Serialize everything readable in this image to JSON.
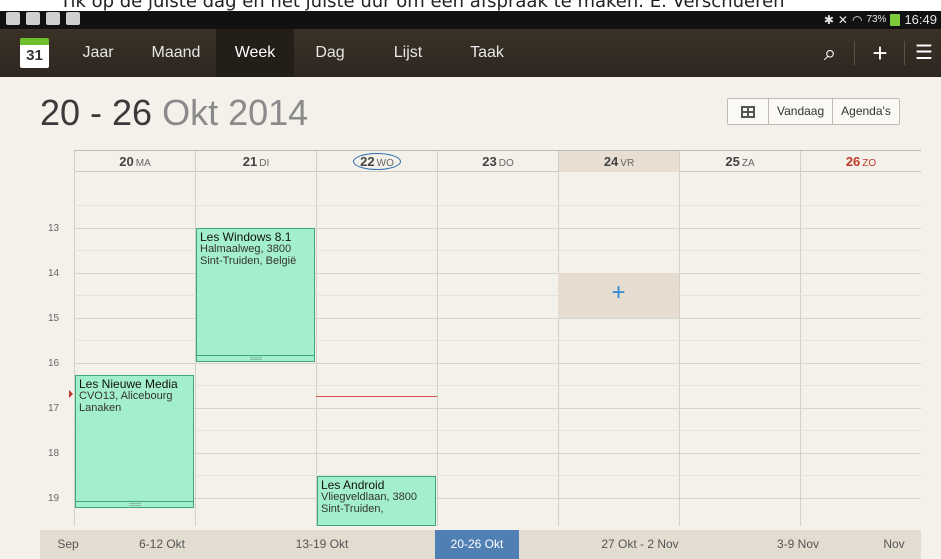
{
  "caption": "Tik op de juiste dag en het juiste uur om een afspraak te maken. E. Verschueren",
  "status": {
    "battery": "73%",
    "time": "16:49"
  },
  "app_icon_day": "31",
  "tabs": [
    {
      "label": "Jaar"
    },
    {
      "label": "Maand"
    },
    {
      "label": "Week"
    },
    {
      "label": "Dag"
    },
    {
      "label": "Lijst"
    },
    {
      "label": "Taak"
    }
  ],
  "active_tab": "Week",
  "actions": {
    "search": "search-icon",
    "add": "+",
    "menu": "menu-icon"
  },
  "heading": {
    "range": "20 - 26",
    "month_year": "Okt 2014"
  },
  "buttons": {
    "today": "Vandaag",
    "calendars": "Agenda's"
  },
  "days": [
    {
      "num": "20",
      "abbr": "MA"
    },
    {
      "num": "21",
      "abbr": "DI"
    },
    {
      "num": "22",
      "abbr": "WO"
    },
    {
      "num": "23",
      "abbr": "DO"
    },
    {
      "num": "24",
      "abbr": "VR"
    },
    {
      "num": "25",
      "abbr": "ZA"
    },
    {
      "num": "26",
      "abbr": "ZO"
    }
  ],
  "hours": [
    "13",
    "14",
    "15",
    "16",
    "17",
    "18",
    "19"
  ],
  "events": [
    {
      "title": "Les Windows 8.1",
      "location": "Halmaalweg, 3800 Sint-Truiden, België"
    },
    {
      "title": "Les Nieuwe Media",
      "location": "CVO13, Alicebourg Lanaken"
    },
    {
      "title": "Les Android",
      "location": "Vliegveldlaan, 3800 Sint-Truiden,"
    }
  ],
  "new_event_symbol": "+",
  "weeks": [
    {
      "label": "Sep"
    },
    {
      "label": "6-12 Okt"
    },
    {
      "label": "13-19 Okt"
    },
    {
      "label": "20-26 Okt"
    },
    {
      "label": "27 Okt - 2 Nov"
    },
    {
      "label": "3-9 Nov"
    },
    {
      "label": "Nov"
    }
  ],
  "colors": {
    "accent": "#4f7fb3",
    "event": "#a4efcb",
    "sunday": "#c0392b"
  }
}
